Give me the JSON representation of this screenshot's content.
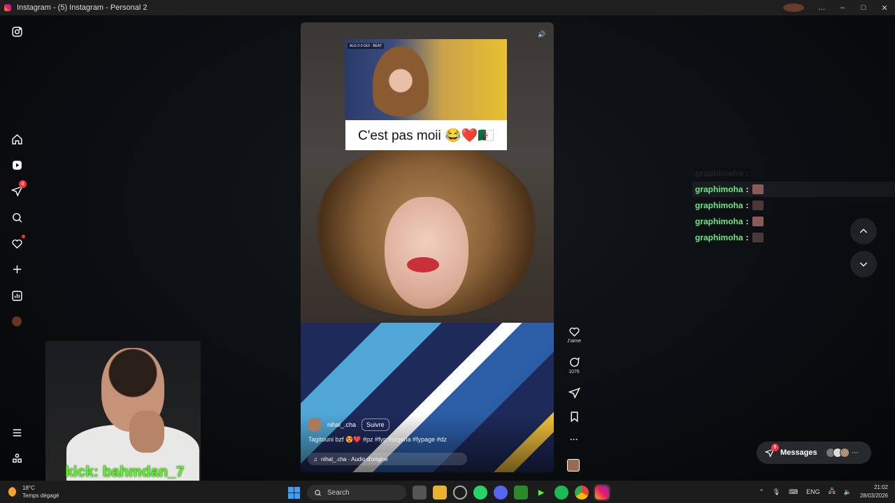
{
  "window": {
    "title": "Instagram - (5) Instagram - Personal 2",
    "controls": [
      "…",
      "–",
      "□",
      "✕"
    ]
  },
  "sidebar": {
    "notifications_badge": "8"
  },
  "reel": {
    "caption_text": "C'est pas moii 😂❤️🇩🇿",
    "author": "nihal_.cha",
    "follow_label": "Suivre",
    "description": "Tagitouni bzf 😍❤️ #pz #fyp #algeria #fypage #dz",
    "audio": "nihal_.cha · Audio d'origine",
    "inset_score": "ALG 0-0 GUI · BEAT"
  },
  "actions": {
    "like_label": "J'aime",
    "comments_count": "1076",
    "more": "···"
  },
  "chat": {
    "faded_user": "graphimoha :",
    "rows": [
      {
        "user": "graphimoha",
        "colon": ":"
      },
      {
        "user": "graphimoha",
        "colon": ":"
      },
      {
        "user": "graphimoha",
        "colon": ":"
      },
      {
        "user": "graphimoha",
        "colon": ":"
      }
    ]
  },
  "messages": {
    "label": "Messages",
    "badge": "5",
    "more": "···"
  },
  "webcam": {
    "overlay_text": "kick: bahmdan_7"
  },
  "taskbar": {
    "weather_temp": "18°C",
    "weather_desc": "Temps dégagé",
    "search_label": "Search",
    "lang": "ENG",
    "time": "21:02",
    "date": "28/03/2026"
  },
  "colors": {
    "chat_user": "#6ee68a",
    "kick_green": "#53fc18",
    "badge_red": "#ff3040"
  }
}
